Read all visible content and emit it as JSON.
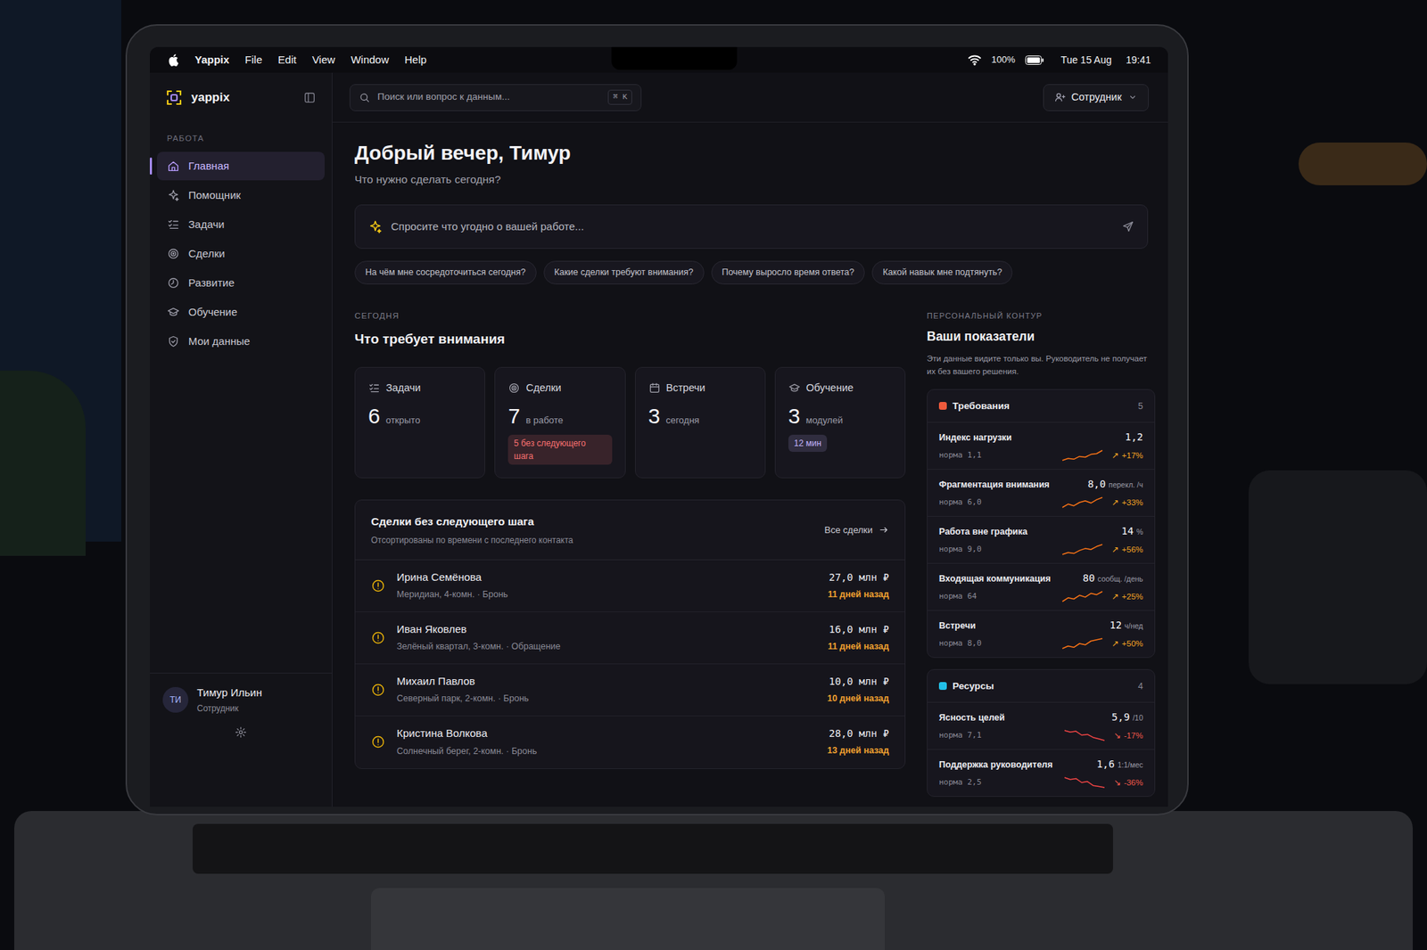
{
  "menubar": {
    "app": "Yappix",
    "items": [
      "File",
      "Edit",
      "View",
      "Window",
      "Help"
    ],
    "battery": "100%",
    "date": "Tue 15 Aug",
    "time": "19:41"
  },
  "sidebar": {
    "logo": "yappix",
    "section": "РАБОТА",
    "items": [
      {
        "label": "Главная",
        "selected": true
      },
      {
        "label": "Помощник",
        "selected": false
      },
      {
        "label": "Задачи",
        "selected": false
      },
      {
        "label": "Сделки",
        "selected": false
      },
      {
        "label": "Развитие",
        "selected": false
      },
      {
        "label": "Обучение",
        "selected": false
      },
      {
        "label": "Мои данные",
        "selected": false
      }
    ],
    "user": {
      "initials": "ТИ",
      "name": "Тимур Ильин",
      "role": "Сотрудник"
    }
  },
  "header": {
    "search_placeholder": "Поиск или вопрос к данным...",
    "shortcut": "⌘ K",
    "role": "Сотрудник"
  },
  "greeting": {
    "title": "Добрый вечер, Тимур",
    "subtitle": "Что нужно сделать сегодня?"
  },
  "ask": {
    "placeholder": "Спросите что угодно о вашей работе..."
  },
  "suggestions": [
    "На чём мне сосредоточиться сегодня?",
    "Какие сделки требуют внимания?",
    "Почему выросло время ответа?",
    "Какой навык мне подтянуть?"
  ],
  "today": {
    "eyebrow": "СЕГОДНЯ",
    "title": "Что требует внимания",
    "cards": [
      {
        "label": "Задачи",
        "value": "6",
        "unit": "открыто"
      },
      {
        "label": "Сделки",
        "value": "7",
        "unit": "в работе",
        "badge": "5 без следующего шага",
        "badge_color": "#f87171"
      },
      {
        "label": "Встречи",
        "value": "3",
        "unit": "сегодня"
      },
      {
        "label": "Обучение",
        "value": "3",
        "unit": "модулей",
        "badge": "12 мин",
        "badge_color": "#c4b5fd"
      }
    ]
  },
  "deals": {
    "title": "Сделки без следующего шага",
    "subtitle": "Отсортированы по времени с последнего контакта",
    "link": "Все сделки",
    "rows": [
      {
        "name": "Ирина Семёнова",
        "details": "Меридиан, 4-комн. · Бронь",
        "amount": "27,0 млн ₽",
        "ago": "11 дней назад"
      },
      {
        "name": "Иван Яковлев",
        "details": "Зелёный квартал, 3-комн. · Обращение",
        "amount": "16,0 млн ₽",
        "ago": "11 дней назад"
      },
      {
        "name": "Михаил Павлов",
        "details": "Северный парк, 2-комн. · Бронь",
        "amount": "10,0 млн ₽",
        "ago": "10 дней назад"
      },
      {
        "name": "Кристина Волкова",
        "details": "Солнечный берег, 2-комн. · Бронь",
        "amount": "28,0 млн ₽",
        "ago": "13 дней назад"
      }
    ]
  },
  "metrics": {
    "eyebrow": "ПЕРСОНАЛЬНЫЙ КОНТУР",
    "title": "Ваши показатели",
    "note": "Эти данные видите только вы. Руководитель не получает их без вашего решения.",
    "groups": [
      {
        "title": "Требования",
        "count": "5",
        "color": "#ef5a3c",
        "items": [
          {
            "name": "Индекс нагрузки",
            "value": "1,2",
            "unit": "",
            "norm": "норма 1,1",
            "arrow": "↗",
            "change": "+17%",
            "kind": "up",
            "series": [
              0.95,
              1.0,
              0.98,
              1.05,
              1.03,
              1.1,
              1.12,
              1.2
            ]
          },
          {
            "name": "Фрагментация внимания",
            "value": "8,0",
            "unit": "перекл. /ч",
            "norm": "норма 6,0",
            "arrow": "↗",
            "change": "+33%",
            "kind": "up",
            "series": [
              6.2,
              6.8,
              6.5,
              7.1,
              7.4,
              7.0,
              7.6,
              8.0
            ]
          },
          {
            "name": "Работа вне графика",
            "value": "14",
            "unit": "%",
            "norm": "норма 9,0",
            "arrow": "↗",
            "change": "+56%",
            "kind": "up",
            "series": [
              9,
              10,
              9.5,
              11,
              12,
              11.5,
              13,
              14
            ]
          },
          {
            "name": "Входящая коммуникация",
            "value": "80",
            "unit": "сообщ. /день",
            "norm": "норма 64",
            "arrow": "↗",
            "change": "+25%",
            "kind": "up",
            "series": [
              64,
              70,
              68,
              74,
              71,
              77,
              75,
              80
            ]
          },
          {
            "name": "Встречи",
            "value": "12",
            "unit": "ч/нед",
            "norm": "норма 8,0",
            "arrow": "↗",
            "change": "+50%",
            "kind": "up",
            "series": [
              8,
              9,
              8.5,
              10,
              9.5,
              11,
              11.5,
              12
            ]
          }
        ]
      },
      {
        "title": "Ресурсы",
        "count": "4",
        "color": "#22c0e8",
        "items": [
          {
            "name": "Ясность целей",
            "value": "5,9",
            "unit": "/10",
            "norm": "норма 7,1",
            "arrow": "↘",
            "change": "-17%",
            "kind": "down",
            "series": [
              7.2,
              7.0,
              7.1,
              6.6,
              6.7,
              6.3,
              6.1,
              5.9
            ]
          },
          {
            "name": "Поддержка руководителя",
            "value": "1,6",
            "unit": "1:1/мес",
            "norm": "норма 2,5",
            "arrow": "↘",
            "change": "-36%",
            "kind": "down",
            "series": [
              2.6,
              2.4,
              2.5,
              2.1,
              2.2,
              1.8,
              1.7,
              1.6
            ]
          }
        ]
      }
    ]
  }
}
